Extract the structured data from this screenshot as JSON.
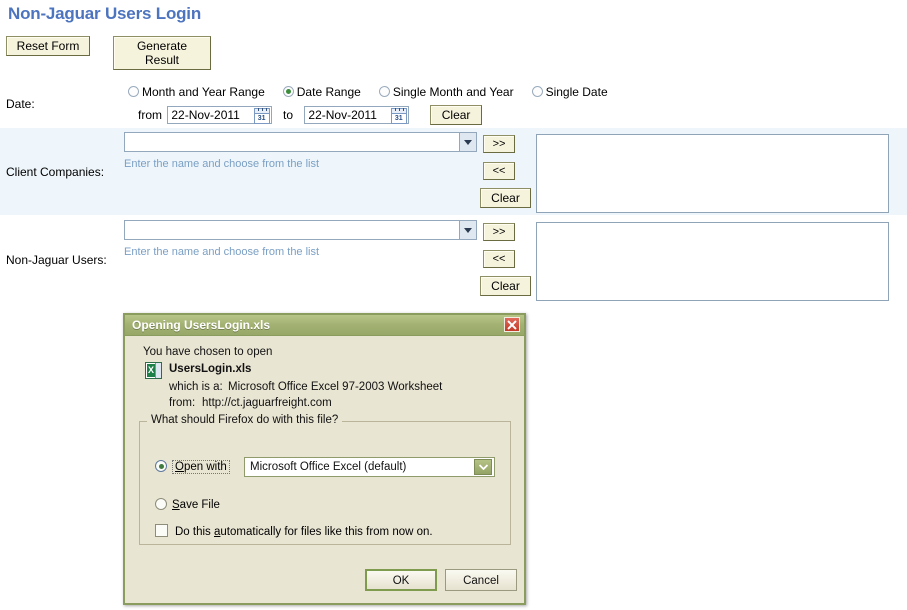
{
  "page": {
    "title": "Non-Jaguar Users Login",
    "title_color": "#4d74bf"
  },
  "toolbar": {
    "reset_label": "Reset Form",
    "generate_label": "Generate Result"
  },
  "date_section": {
    "label": "Date:",
    "options": [
      {
        "label": "Month and Year Range",
        "selected": false
      },
      {
        "label": "Date Range",
        "selected": true
      },
      {
        "label": "Single Month and Year",
        "selected": false
      },
      {
        "label": "Single Date",
        "selected": false
      }
    ],
    "from_label": "from",
    "from_value": "22-Nov-2011",
    "to_label": "to",
    "to_value": "22-Nov-2011",
    "clear_label": "Clear",
    "calendar_icon_day": "31"
  },
  "client_companies": {
    "label": "Client Companies:",
    "input_value": "",
    "input_placeholder": "",
    "hint": "Enter the name and choose from the list",
    "add_label": ">>",
    "remove_label": "<<",
    "clear_label": "Clear",
    "selected_items": [],
    "row_background": "#eef6fb"
  },
  "non_jaguar_users": {
    "label": "Non-Jaguar Users:",
    "input_value": "",
    "input_placeholder": "",
    "hint": "Enter the name and choose from the list",
    "add_label": ">>",
    "remove_label": "<<",
    "clear_label": "Clear",
    "selected_items": [],
    "row_background": "#ffffff"
  },
  "dialog": {
    "title": "Opening UsersLogin.xls",
    "titlebar_color": "#a4b374",
    "body_color": "#e9e5d3",
    "chosen_text": "You have chosen to open",
    "file_name": "UsersLogin.xls",
    "which_is_a_label": "which is a:",
    "which_is_a_value": "Microsoft Office Excel 97-2003 Worksheet",
    "from_label": "from:",
    "from_value": "http://ct.jaguarfreight.com",
    "fieldset_legend": "What should Firefox do with this file?",
    "open_with": {
      "label": "Open with",
      "accesskey": "O",
      "selected": true,
      "selected_option": "Microsoft Office Excel (default)"
    },
    "save_file": {
      "label": "Save File",
      "accesskey": "S",
      "selected": false
    },
    "auto_checkbox": {
      "label_before": "Do this ",
      "accesskey": "a",
      "label_after": "utomatically for files like this from now on.",
      "checked": false
    },
    "ok_label": "OK",
    "cancel_label": "Cancel"
  }
}
